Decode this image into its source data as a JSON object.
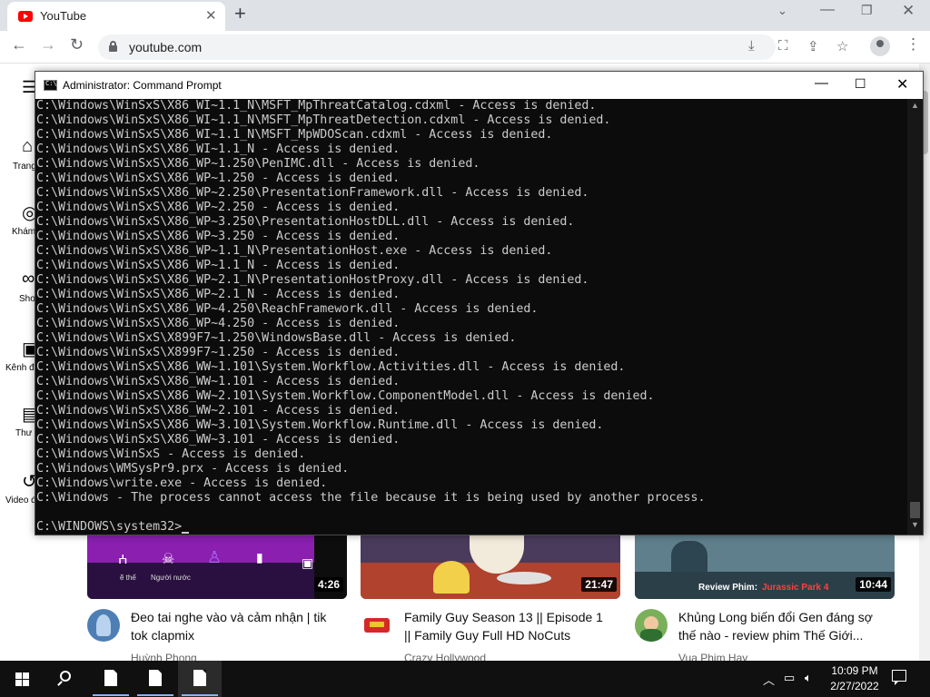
{
  "browser": {
    "tab_title": "YouTube",
    "url": "youtube.com",
    "new_tab_icon": "plus-icon",
    "tab_close_icon": "close-icon"
  },
  "youtube": {
    "sidebar": [
      {
        "label": "Trang",
        "icon": "home-icon"
      },
      {
        "label": "Khám",
        "icon": "explore-icon"
      },
      {
        "label": "Sho",
        "icon": "shorts-icon"
      },
      {
        "label": "Kênh đ",
        "icon": "subscriptions-icon"
      },
      {
        "label": "Thư",
        "icon": "library-icon"
      },
      {
        "label": "Video đ",
        "icon": "history-icon"
      }
    ],
    "videos": [
      {
        "duration": "4:26",
        "title": "Đeo tai nghe vào và cảm nhận | tik tok clapmix",
        "channel": "Huỳnh Phong",
        "thumb_text_1": "Người nước",
        "thumb_text_2": "ẽ thế"
      },
      {
        "duration": "21:47",
        "title": "Family Guy Season 13 || Episode 1 || Family Guy Full HD NoCuts",
        "channel": "Crazy Hollywood"
      },
      {
        "duration": "10:44",
        "title": "Khủng Long biến đổi Gen đáng sợ thế nào - review phim Thế Giới...",
        "channel": "Vua Phim Hay",
        "thumb_caption": "Review Phim: ",
        "thumb_caption_highlight": "Jurassic Park 4"
      }
    ]
  },
  "cmd": {
    "title": "Administrator: Command Prompt",
    "lines": [
      "C:\\Windows\\WinSxS\\X86_WI~1.1_N\\MSFT_MpThreatCatalog.cdxml - Access is denied.",
      "C:\\Windows\\WinSxS\\X86_WI~1.1_N\\MSFT_MpThreatDetection.cdxml - Access is denied.",
      "C:\\Windows\\WinSxS\\X86_WI~1.1_N\\MSFT_MpWDOScan.cdxml - Access is denied.",
      "C:\\Windows\\WinSxS\\X86_WI~1.1_N - Access is denied.",
      "C:\\Windows\\WinSxS\\X86_WP~1.250\\PenIMC.dll - Access is denied.",
      "C:\\Windows\\WinSxS\\X86_WP~1.250 - Access is denied.",
      "C:\\Windows\\WinSxS\\X86_WP~2.250\\PresentationFramework.dll - Access is denied.",
      "C:\\Windows\\WinSxS\\X86_WP~2.250 - Access is denied.",
      "C:\\Windows\\WinSxS\\X86_WP~3.250\\PresentationHostDLL.dll - Access is denied.",
      "C:\\Windows\\WinSxS\\X86_WP~3.250 - Access is denied.",
      "C:\\Windows\\WinSxS\\X86_WP~1.1_N\\PresentationHost.exe - Access is denied.",
      "C:\\Windows\\WinSxS\\X86_WP~1.1_N - Access is denied.",
      "C:\\Windows\\WinSxS\\X86_WP~2.1_N\\PresentationHostProxy.dll - Access is denied.",
      "C:\\Windows\\WinSxS\\X86_WP~2.1_N - Access is denied.",
      "C:\\Windows\\WinSxS\\X86_WP~4.250\\ReachFramework.dll - Access is denied.",
      "C:\\Windows\\WinSxS\\X86_WP~4.250 - Access is denied.",
      "C:\\Windows\\WinSxS\\X899F7~1.250\\WindowsBase.dll - Access is denied.",
      "C:\\Windows\\WinSxS\\X899F7~1.250 - Access is denied.",
      "C:\\Windows\\WinSxS\\X86_WW~1.101\\System.Workflow.Activities.dll - Access is denied.",
      "C:\\Windows\\WinSxS\\X86_WW~1.101 - Access is denied.",
      "C:\\Windows\\WinSxS\\X86_WW~2.101\\System.Workflow.ComponentModel.dll - Access is denied.",
      "C:\\Windows\\WinSxS\\X86_WW~2.101 - Access is denied.",
      "C:\\Windows\\WinSxS\\X86_WW~3.101\\System.Workflow.Runtime.dll - Access is denied.",
      "C:\\Windows\\WinSxS\\X86_WW~3.101 - Access is denied.",
      "C:\\Windows\\WinSxS - Access is denied.",
      "C:\\Windows\\WMSysPr9.prx - Access is denied.",
      "C:\\Windows\\write.exe - Access is denied.",
      "C:\\Windows - The process cannot access the file because it is being used by another process.",
      ""
    ],
    "prompt": "C:\\WINDOWS\\system32>"
  },
  "taskbar": {
    "time": "10:09 PM",
    "date": "2/27/2022",
    "tray_icons": [
      "chevron-up-icon",
      "network-icon",
      "volume-icon"
    ]
  },
  "colors": {
    "cmd_bg": "#0c0c0c",
    "cmd_text": "#cccccc",
    "youtube_red": "#ff0000",
    "taskbar_bg": "#101010"
  }
}
